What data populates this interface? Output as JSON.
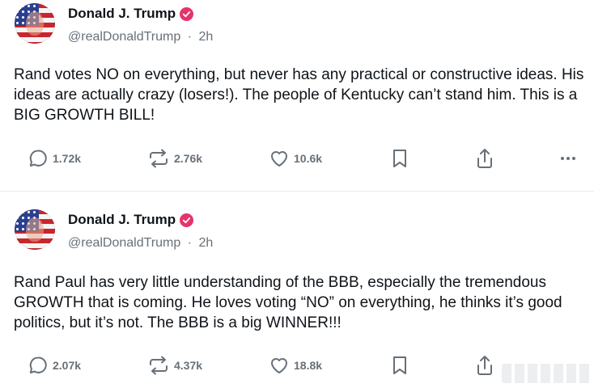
{
  "posts": [
    {
      "author": "Donald J. Trump",
      "handle": "@realDonaldTrump",
      "time": "2h",
      "text": "Rand votes NO on everything, but never has any practical or constructive ideas. His ideas are actually crazy (losers!). The people of Kentucky can’t stand him. This is a BIG GROWTH BILL!",
      "replies": "1.72k",
      "reposts": "2.76k",
      "likes": "10.6k"
    },
    {
      "author": "Donald J. Trump",
      "handle": "@realDonaldTrump",
      "time": "2h",
      "text": "Rand Paul has very little understanding of the BBB, especially the tremendous GROWTH that is coming. He loves voting “NO” on everything, he thinks it’s good politics, but it’s not. The BBB is a big WINNER!!!",
      "replies": "2.07k",
      "reposts": "4.37k",
      "likes": "18.8k"
    }
  ],
  "separator": "·",
  "colors": {
    "badge": "#e5346b",
    "muted": "#677079",
    "text": "#0f1419"
  },
  "icons": [
    "verified-badge-icon",
    "reply-icon",
    "repost-icon",
    "like-icon",
    "bookmark-icon",
    "share-icon",
    "more-icon"
  ]
}
